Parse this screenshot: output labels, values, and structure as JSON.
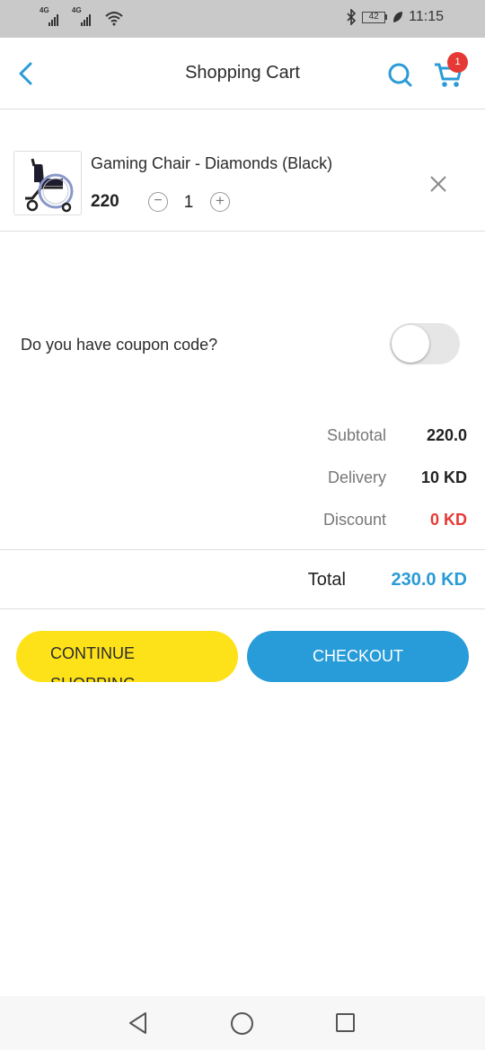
{
  "status_bar": {
    "sim1_label": "4G",
    "sim2_label": "4G",
    "battery": "42",
    "time": "11:15",
    "icons": [
      "signal-icon",
      "wifi-icon",
      "bluetooth-icon",
      "battery-icon",
      "leaf-icon"
    ]
  },
  "header": {
    "title": "Shopping Cart",
    "cart_count": "1",
    "icons": [
      "back-arrow-icon",
      "search-icon",
      "cart-icon"
    ],
    "accent_color": "#2a9bd6",
    "badge_color": "#e53935"
  },
  "cart_items": [
    {
      "name": "Gaming Chair - Diamonds (Black)",
      "price": "220",
      "quantity": "1",
      "minus_symbol": "−",
      "plus_symbol": "+",
      "image": "wheelchair-image"
    }
  ],
  "coupon": {
    "label": "Do you  have coupon code?",
    "enabled": false
  },
  "summary": {
    "subtotal_label": "Subtotal",
    "subtotal_value": "220.0",
    "delivery_label": "Delivery",
    "delivery_value": "10 KD",
    "discount_label": "Discount",
    "discount_value": "0 KD",
    "total_label": "Total",
    "total_value": "230.0 KD",
    "discount_color": "#e53935"
  },
  "actions": {
    "continue_label": "CONTINUE SHOPPING",
    "checkout_label": "CHECKOUT",
    "continue_color": "#fde21a",
    "checkout_color": "#279cd9"
  },
  "nav_bar": {
    "icons": [
      "back-triangle-icon",
      "home-circle-icon",
      "recents-square-icon"
    ]
  }
}
